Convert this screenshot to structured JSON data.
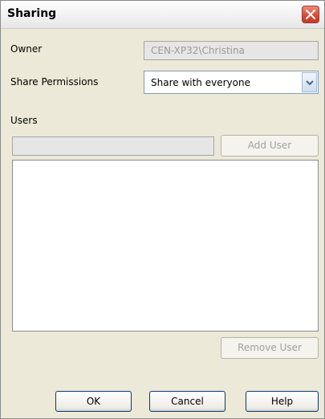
{
  "window": {
    "title": "Sharing"
  },
  "owner": {
    "label": "Owner",
    "value": "CEN-XP32\\Christina"
  },
  "share_permissions": {
    "label": "Share Permissions",
    "selected": "Share with everyone"
  },
  "users": {
    "label": "Users",
    "input_value": "",
    "add_user_label": "Add User",
    "remove_user_label": "Remove User",
    "items": []
  },
  "buttons": {
    "ok": "OK",
    "cancel": "Cancel",
    "help": "Help"
  },
  "colors": {
    "close_button": "#d24a35",
    "disabled_text": "#a0a0a0",
    "default_button_border": "#003c74"
  },
  "icons": {
    "close": "close-icon",
    "dropdown": "chevron-down-icon"
  }
}
